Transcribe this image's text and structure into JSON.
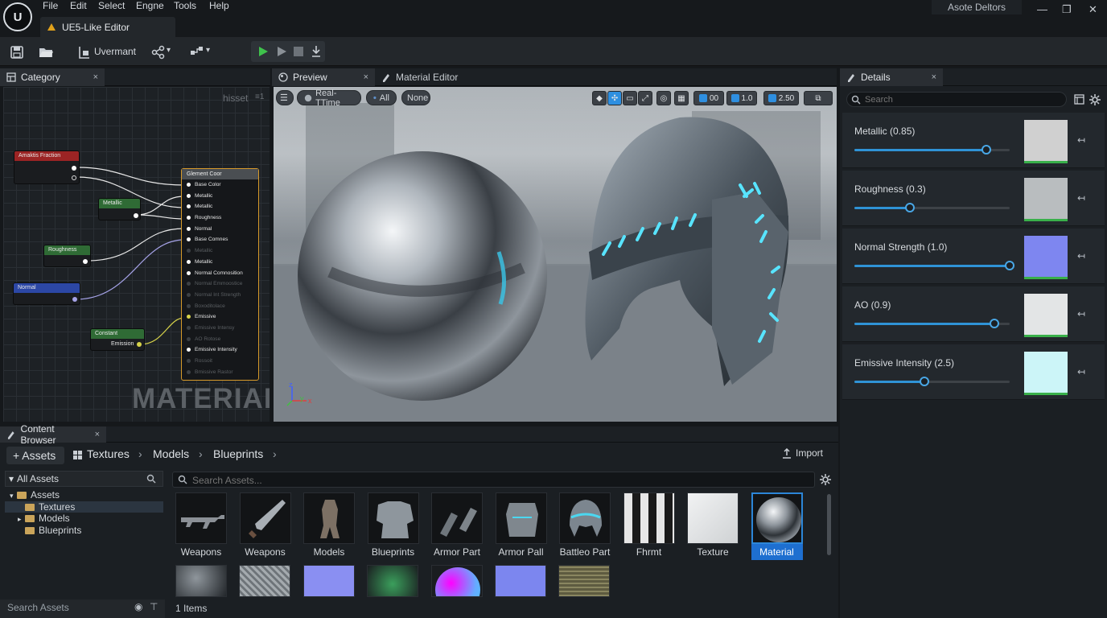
{
  "app": {
    "logo": "U",
    "title": "UE5-Like Editor",
    "profile": "Asote Deltors"
  },
  "menu": [
    "File",
    "Edit",
    "Select",
    "Engne",
    "Tools",
    "Help"
  ],
  "window_buttons": {
    "minimize": "—",
    "maximize": "❐",
    "close": "✕"
  },
  "toolbar": {
    "mode_label": "Uvermant"
  },
  "left_panel": {
    "tab": "Category",
    "close": "×",
    "graph_label": "hisset",
    "graph_label2": "≡1",
    "watermark": "MATERIAL",
    "nodes": [
      {
        "label": "Amaktis Fraction",
        "color": "#9b2424"
      },
      {
        "label": "Metallic",
        "color": "#2f6b35"
      },
      {
        "label": "Roughness",
        "color": "#2f6b35"
      },
      {
        "label": "Normal",
        "color": "#2c47a5"
      },
      {
        "label": "Constant",
        "color": "#2f6b35",
        "output": "Emission"
      }
    ],
    "material_node": {
      "title": "Glement Coor",
      "rows": [
        {
          "t": "Base Color",
          "s": "on"
        },
        {
          "t": "Metallic",
          "s": "on"
        },
        {
          "t": "Metallic",
          "s": "on"
        },
        {
          "t": "Roughness",
          "s": "on"
        },
        {
          "t": "Normal",
          "s": "on"
        },
        {
          "t": "Base Comnes",
          "s": "on"
        },
        {
          "t": "Metallic",
          "s": "dim"
        },
        {
          "t": "Metallic",
          "s": "on"
        },
        {
          "t": "Normal Comnosition",
          "s": "on"
        },
        {
          "t": "Normal Emmoostice",
          "s": "dim"
        },
        {
          "t": "Normal Int Strength",
          "s": "dim"
        },
        {
          "t": "Boxoditolace",
          "s": "dim"
        },
        {
          "t": "Emissive",
          "s": "yellow"
        },
        {
          "t": "Emissive Intensy",
          "s": "dim"
        },
        {
          "t": "AO Rotose",
          "s": "dim"
        },
        {
          "t": "Emissive Intensity",
          "s": "on"
        },
        {
          "t": "Rossoit",
          "s": "dim"
        },
        {
          "t": "Bmissive Rastor",
          "s": "dim"
        }
      ]
    }
  },
  "viewport": {
    "tab_preview": "Preview",
    "tab_material": "Material Editor",
    "close": "×",
    "buttons": {
      "menu": "☰",
      "realtime": "Real-TTime",
      "all": "All",
      "none": "None"
    },
    "icons": {
      "v1": "00",
      "v2": "1.0",
      "v3": "2.50"
    },
    "axis": {
      "z": "z",
      "y": "y",
      "x": "x"
    }
  },
  "details": {
    "tab": "Details",
    "close": "×",
    "search_placeholder": "Search",
    "params": [
      {
        "label": "Metallic (0.85)",
        "value": 0.85,
        "thumb": "#d0d0d0"
      },
      {
        "label": "Roughness (0.3)",
        "value": 0.36,
        "thumb": "#b9bdbf"
      },
      {
        "label": "Normal Strength (1.0)",
        "value": 1.0,
        "thumb": "#7e86f0"
      },
      {
        "label": "AO (0.9)",
        "value": 0.9,
        "thumb": "#e3e5e6"
      },
      {
        "label": "Emissive Intensity (2.5)",
        "value": 0.45,
        "thumb": "#ccf5f8"
      }
    ]
  },
  "content_browser": {
    "tab": "Content Browser",
    "close": "×",
    "add": "+ Assets",
    "crumbs": [
      "Textures",
      "Models",
      "Blueprints"
    ],
    "sep": "›",
    "import": "Import",
    "tree_header": "All Assets",
    "tree": [
      {
        "label": "Assets",
        "level": 0,
        "exp": "▾"
      },
      {
        "label": "Textures",
        "level": 1,
        "exp": ""
      },
      {
        "label": "Models",
        "level": 1,
        "exp": "▸"
      },
      {
        "label": "Blueprints",
        "level": 1,
        "exp": ""
      }
    ],
    "search_placeholder": "Search Assets...",
    "tree_search": "Search Assets",
    "status": "1 Items",
    "assets": [
      {
        "label": "Weapons",
        "icon": "rifle-icon"
      },
      {
        "label": "Weapons",
        "icon": "sword-icon"
      },
      {
        "label": "Models",
        "icon": "armor-figure-icon"
      },
      {
        "label": "Blueprints",
        "icon": "chestplate-icon"
      },
      {
        "label": "Armor Part",
        "icon": "gauntlet-icon"
      },
      {
        "label": "Armor Pall",
        "icon": "cuirass-icon"
      },
      {
        "label": "Battleo Part",
        "icon": "helmet-icon"
      },
      {
        "label": "Fhrmt",
        "icon": "texture-bw-icon"
      },
      {
        "label": "Texture",
        "icon": "texture-white-icon"
      },
      {
        "label": "Material",
        "icon": "chrome-sphere-icon"
      }
    ]
  }
}
